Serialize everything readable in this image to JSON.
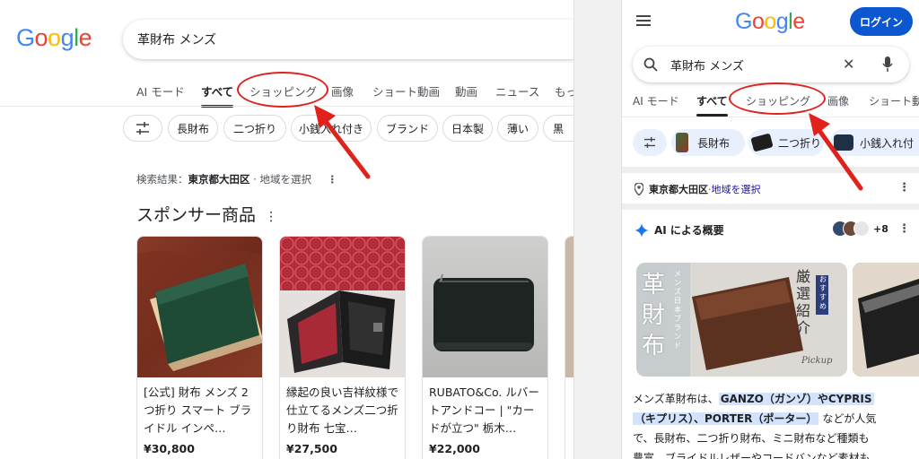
{
  "desktop": {
    "logo": [
      "G",
      "o",
      "o",
      "g",
      "l",
      "e"
    ],
    "search_query": "革財布 メンズ",
    "tabs": [
      "AI モード",
      "すべて",
      "ショッピング",
      "画像",
      "ショート動画",
      "動画",
      "ニュース",
      "もっ"
    ],
    "chips": [
      "長財布",
      "二つ折り",
      "小銭入れ付き",
      "ブランド",
      "日本製",
      "薄い",
      "黒"
    ],
    "location_prefix": "検索結果：",
    "location_name": "東京都大田区",
    "location_link": "· 地域を選択",
    "sponsored_title": "スポンサー商品",
    "products": [
      {
        "title": "[公式] 財布 メンズ 2つ折り スマート ブライドル インペ…",
        "price": "¥30,800"
      },
      {
        "title": "縁起の良い吉祥紋様で仕立てるメンズ二つ折り財布 七宝…",
        "price": "¥27,500"
      },
      {
        "title": "RUBATO&Co. ルバートアンドコー | \"カードが立つ\" 栃木…",
        "price": "¥22,000"
      }
    ]
  },
  "mobile": {
    "logo": [
      "G",
      "o",
      "o",
      "g",
      "l",
      "e"
    ],
    "login_label": "ログイン",
    "search_query": "革財布 メンズ",
    "tabs": [
      "AI モード",
      "すべて",
      "ショッピング",
      "画像",
      "ショート動"
    ],
    "chips": [
      "長財布",
      "二つ折り",
      "小銭入れ付"
    ],
    "location_name": "東京都大田区",
    "location_sep": " · ",
    "location_link": "地域を選択",
    "ai_overview_title": "AI による概要",
    "ai_sources_count": "+8",
    "banner_text_big": "革財布",
    "banner_text_side": "メンズ 日本ブランド",
    "banner_text_right": "厳選紹介",
    "banner_badge": "おすすめ",
    "banner_script": "Pickup",
    "overview_line1_a": "メンズ革財布は、",
    "overview_line1_b": "GANZO（ガンゾ）やCYPRIS",
    "overview_line2_a": "（キプリス）、PORTER（ポーター）",
    "overview_line2_b": "などが人気",
    "overview_line3": "で、長財布、二つ折り財布、ミニ財布など種類も",
    "overview_line4": "豊富、ブライドルレザーやコードバンなど素材も"
  },
  "colors": {
    "g_blue": "#4285f4",
    "g_red": "#ea4335",
    "g_yellow": "#fbbc05",
    "g_green": "#34a853",
    "annotation_red": "#e0211c",
    "link_blue": "#1a0dab",
    "login_blue": "#0b57d0",
    "highlight": "#d3e3fd"
  }
}
